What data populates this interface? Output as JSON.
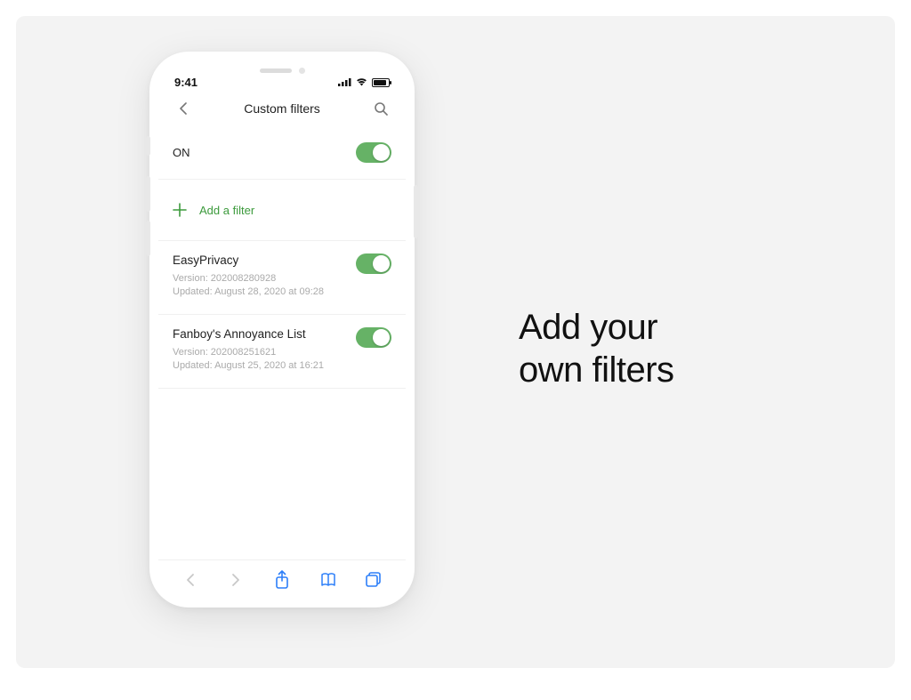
{
  "status": {
    "time": "9:41"
  },
  "nav": {
    "title": "Custom filters"
  },
  "master_toggle": {
    "label": "ON"
  },
  "add_filter": {
    "label": "Add a filter"
  },
  "filters": [
    {
      "name": "EasyPrivacy",
      "version": "Version: 202008280928",
      "updated": "Updated: August 28, 2020 at 09:28"
    },
    {
      "name": "Fanboy's Annoyance List",
      "version": "Version: 202008251621",
      "updated": "Updated: August 25, 2020 at 16:21"
    }
  ],
  "headline": {
    "line1": "Add your",
    "line2": "own filters"
  }
}
